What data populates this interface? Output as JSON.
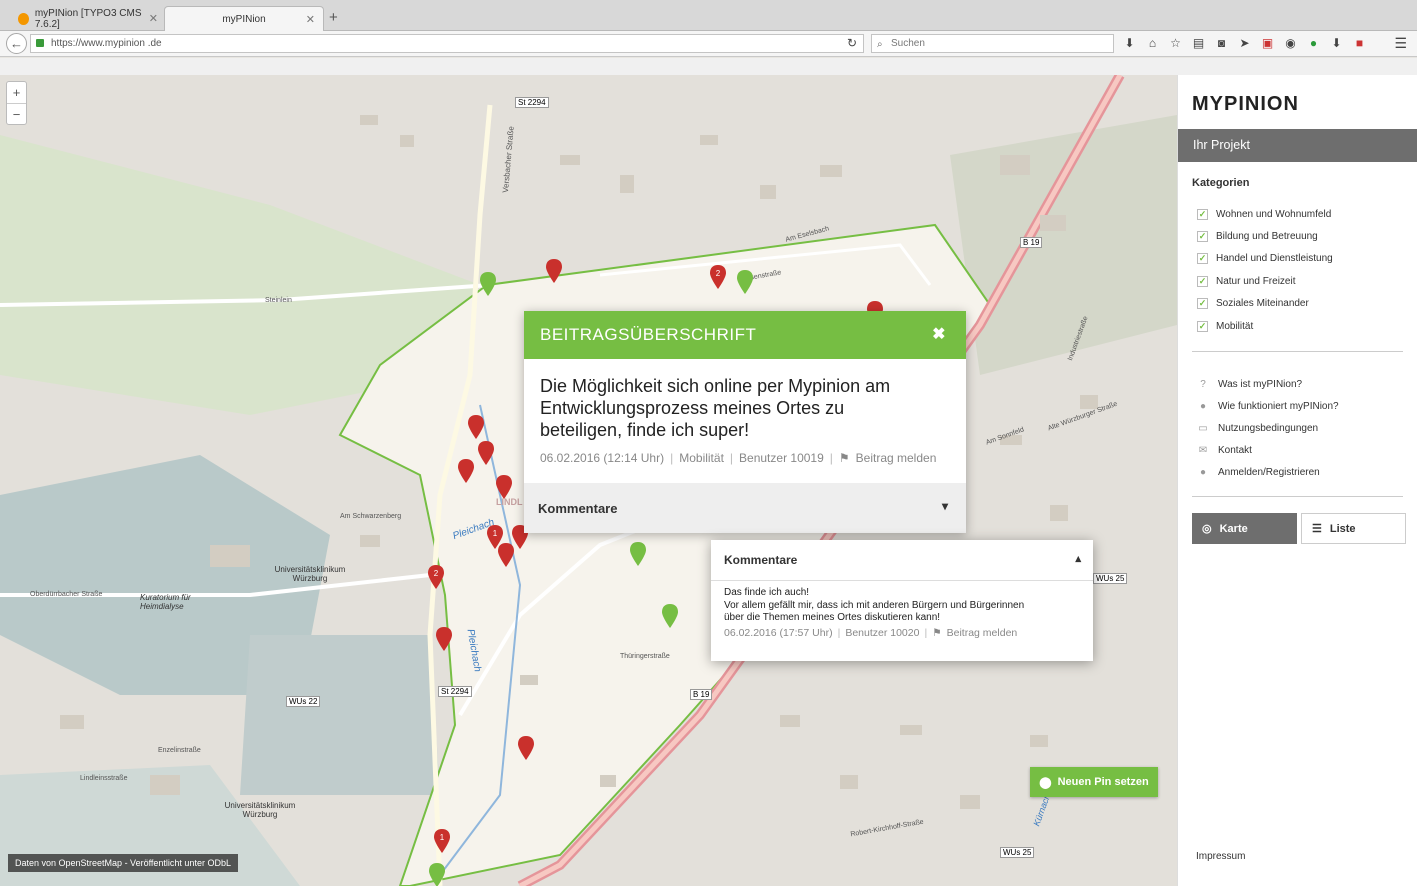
{
  "browser": {
    "tabs": [
      {
        "title": "myPINion [TYPO3 CMS 7.6.2]",
        "active": false
      },
      {
        "title": "myPINion",
        "active": true
      }
    ],
    "url": "https://www.mypinion .de",
    "search_placeholder": "Suchen"
  },
  "map": {
    "zoom_in": "+",
    "zoom_out": "−",
    "attribution": "Daten von OpenStreetMap - Veröffentlicht unter ODbL",
    "new_pin_label": "Neuen Pin setzen",
    "street_labels": [
      "St 2294",
      "St 2294",
      "B 19",
      "B 19",
      "WUs 22",
      "WUs 25",
      "WUs 25",
      "Pleichach",
      "Pleichach",
      "Versbacher Straße",
      "Universitätsklinikum Würzburg",
      "Universitätsklinikum Würzburg",
      "Kuratorium für Heimdialyse",
      "Oberdürrbacher Straße",
      "Lindleinsstraße",
      "Enzelinstraße",
      "Thüringerstraße",
      "Am Schwarzenberg",
      "Hessenstraße",
      "Alte Würzburger Straße",
      "Steinlein",
      "Am Eselsbach",
      "Am Sonnfeld",
      "Industriestraße",
      "Kürnach",
      "Robert-Kirchhoff-Straße",
      "LINDL"
    ]
  },
  "popup": {
    "title": "BEITRAGSÜBERSCHRIFT",
    "close": "✖",
    "text": "Die Möglichkeit sich online per Mypinion am Entwicklungsprozess meines Ortes zu beteiligen, finde ich super!",
    "date": "06.02.2016 (12:14 Uhr)",
    "category": "Mobilität",
    "user": "Benutzer 10019",
    "report": "Beitrag melden",
    "comments_label": "Kommentare"
  },
  "comment_panel": {
    "title": "Kommentare",
    "line1": "Das finde ich auch!",
    "line2": "Vor allem gefällt mir, dass ich mit anderen Bürgern und Bürgerinnen",
    "line3": "über die Themen meines Ortes diskutieren kann!",
    "date": "06.02.2016 (17:57 Uhr)",
    "user": "Benutzer 10020",
    "report": "Beitrag melden"
  },
  "sidebar": {
    "logo": "MYPINION",
    "project": "Ihr Projekt",
    "categories_title": "Kategorien",
    "categories": [
      {
        "label": "Wohnen und Wohnumfeld",
        "checked": true
      },
      {
        "label": "Bildung und Betreuung",
        "checked": true
      },
      {
        "label": "Handel und Dienstleistung",
        "checked": true
      },
      {
        "label": "Natur und Freizeit",
        "checked": true
      },
      {
        "label": "Soziales Miteinander",
        "checked": true
      },
      {
        "label": "Mobilität",
        "checked": true
      }
    ],
    "links": [
      {
        "label": "Was ist myPINion?",
        "icon": "question-icon"
      },
      {
        "label": "Wie funktioniert myPINion?",
        "icon": "pin-icon"
      },
      {
        "label": "Nutzungsbedingungen",
        "icon": "document-icon"
      },
      {
        "label": "Kontakt",
        "icon": "mail-icon"
      },
      {
        "label": "Anmelden/Registrieren",
        "icon": "user-icon"
      }
    ],
    "view_map": "Karte",
    "view_list": "Liste",
    "impressum": "Impressum"
  },
  "colors": {
    "accent_green": "#76be43",
    "pin_red": "#c9302c",
    "sidebar_grey": "#6e6e6e"
  }
}
